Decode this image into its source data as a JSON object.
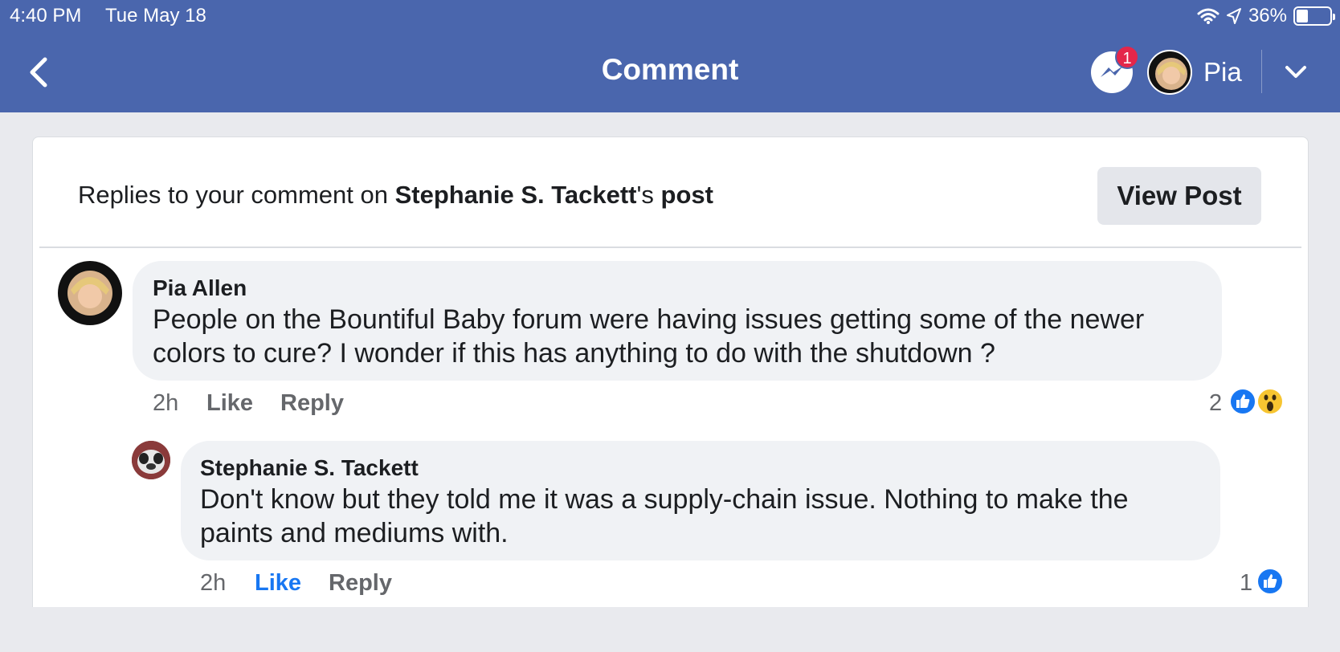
{
  "status_bar": {
    "time": "4:40 PM",
    "date": "Tue May 18",
    "battery": "36%"
  },
  "nav": {
    "title": "Comment",
    "messenger_badge": "1",
    "user_name": "Pia"
  },
  "header": {
    "prefix": "Replies to your comment on ",
    "author": "Stephanie S. Tackett",
    "possessive": "'s ",
    "post_word": "post",
    "view_post_label": "View Post"
  },
  "comments": [
    {
      "author": "Pia Allen",
      "lines": [
        "People on the Bountiful Baby forum were having issues getting some of the newer",
        "colors to cure? I wonder if this has anything to do with the shutdown ?"
      ],
      "time": "2h",
      "like_label": "Like",
      "reply_label": "Reply",
      "reaction_count": "2"
    },
    {
      "author": "Stephanie S. Tackett",
      "lines": [
        "Don't know but they told me it was a supply-chain issue.  Nothing to make the",
        "paints and mediums with."
      ],
      "time": "2h",
      "like_label": "Like",
      "reply_label": "Reply",
      "reaction_count": "1"
    }
  ],
  "colors": {
    "nav_bar": "#4a66ad",
    "like_blue": "#1877f2",
    "badge_red": "#e4264a",
    "bubble": "#f0f2f5"
  }
}
